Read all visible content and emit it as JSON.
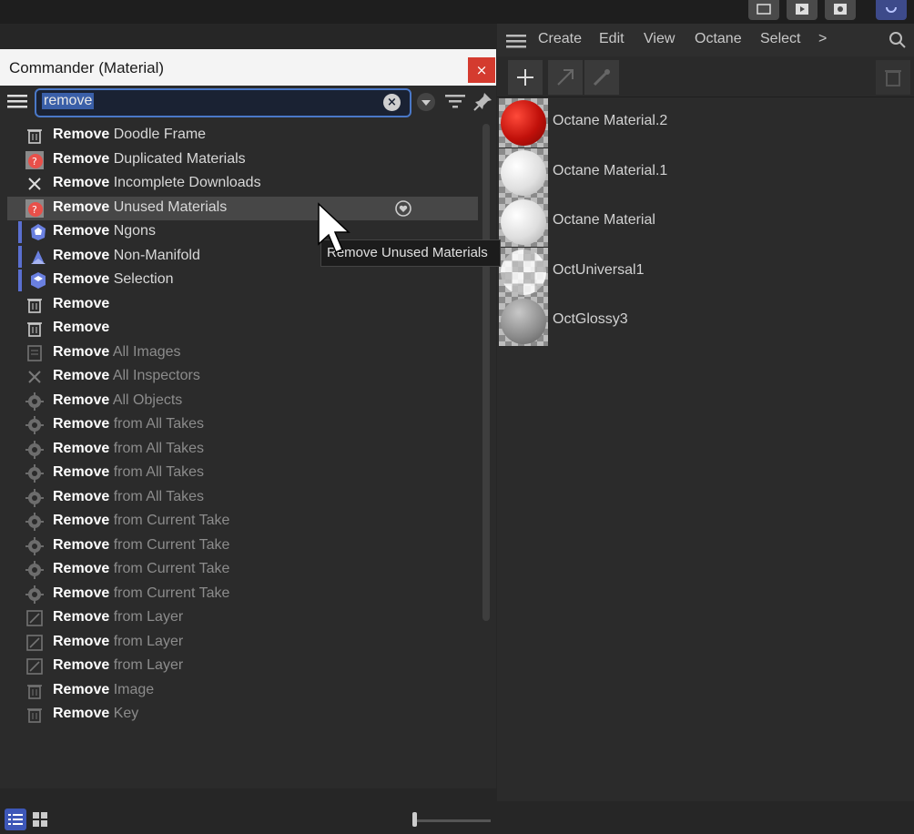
{
  "commander": {
    "title": "Commander (Material)",
    "close_label": "×",
    "search_value": "remove",
    "clear_label": "×",
    "keyword": "Remove",
    "tooltip": "Remove Unused Materials",
    "rows": [
      {
        "rest": "Doodle Frame",
        "icon": "trash-icon"
      },
      {
        "rest": "Duplicated Materials",
        "icon": "material-remove-icon"
      },
      {
        "rest": "Incomplete Downloads",
        "icon": "x-icon"
      },
      {
        "rest": "Unused Materials",
        "icon": "material-remove-icon"
      },
      {
        "rest": "Ngons",
        "icon": "ngon-icon"
      },
      {
        "rest": "Non-Manifold",
        "icon": "manifold-icon"
      },
      {
        "rest": "Selection",
        "icon": "selection-icon"
      },
      {
        "rest": "",
        "icon": "trash-icon"
      },
      {
        "rest": "",
        "icon": "trash-icon"
      },
      {
        "rest": "All Images",
        "icon": "image-icon"
      },
      {
        "rest": "All Inspectors",
        "icon": "x-icon"
      },
      {
        "rest": "All Objects",
        "icon": "gear-icon"
      },
      {
        "rest": "from All Takes",
        "icon": "gear-icon"
      },
      {
        "rest": "from All Takes",
        "icon": "gear-icon"
      },
      {
        "rest": "from All Takes",
        "icon": "gear-icon"
      },
      {
        "rest": "from All Takes",
        "icon": "gear-icon"
      },
      {
        "rest": "from Current Take",
        "icon": "gear-icon"
      },
      {
        "rest": "from Current Take",
        "icon": "gear-icon"
      },
      {
        "rest": "from Current Take",
        "icon": "gear-icon"
      },
      {
        "rest": "from Current Take",
        "icon": "gear-icon"
      },
      {
        "rest": "from Layer",
        "icon": "layer-icon"
      },
      {
        "rest": "from Layer",
        "icon": "layer-icon"
      },
      {
        "rest": "from Layer",
        "icon": "layer-icon"
      },
      {
        "rest": "Image",
        "icon": "trash-icon"
      },
      {
        "rest": "Key",
        "icon": "trash-icon"
      }
    ]
  },
  "material_manager": {
    "menu": [
      "Create",
      "Edit",
      "View",
      "Octane",
      "Select",
      ">"
    ],
    "materials": [
      {
        "name": "Octane Material.2",
        "color": "#d0150e"
      },
      {
        "name": "Octane Material.1",
        "color": "#e8e8e8"
      },
      {
        "name": "Octane Material",
        "color": "#e6e6e6"
      },
      {
        "name": "OctUniversal1",
        "color": "#d4d4d4"
      },
      {
        "name": "OctGlossy3",
        "color": "#9a9a9a"
      }
    ]
  },
  "colors": {
    "accent": "#4a78c8",
    "close": "#d43b2f",
    "keyword_bar": "#5a6fd0"
  }
}
